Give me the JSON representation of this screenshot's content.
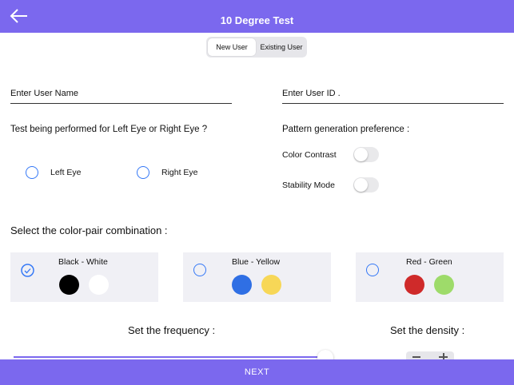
{
  "header": {
    "title": "10 Degree Test",
    "back_icon": "arrow-left-icon",
    "color": "#7b68ee"
  },
  "user_type": {
    "options": [
      "New User",
      "Existing User"
    ],
    "selected": "New User"
  },
  "form": {
    "user_name_placeholder": "Enter User Name",
    "user_id_placeholder": "Enter User ID ."
  },
  "eye": {
    "question": "Test being performed for Left Eye or Right Eye ?",
    "left": "Left Eye",
    "right": "Right Eye"
  },
  "pattern": {
    "title": "Pattern generation preference :",
    "color_contrast": "Color Contrast",
    "stability_mode": "Stability Mode"
  },
  "color_pair": {
    "title": "Select the color-pair combination :",
    "options": [
      {
        "name": "Black - White",
        "colors": [
          "#000000",
          "#ffffff"
        ],
        "selected": true
      },
      {
        "name": "Blue - Yellow",
        "colors": [
          "#2f6fe4",
          "#f7d757"
        ],
        "selected": false
      },
      {
        "name": "Red - Green",
        "colors": [
          "#cf2a2a",
          "#9edb6a"
        ],
        "selected": false
      }
    ]
  },
  "frequency": {
    "title": "Set the frequency :"
  },
  "density": {
    "title": "Set the density :"
  },
  "footer": {
    "next_label": "NEXT"
  }
}
